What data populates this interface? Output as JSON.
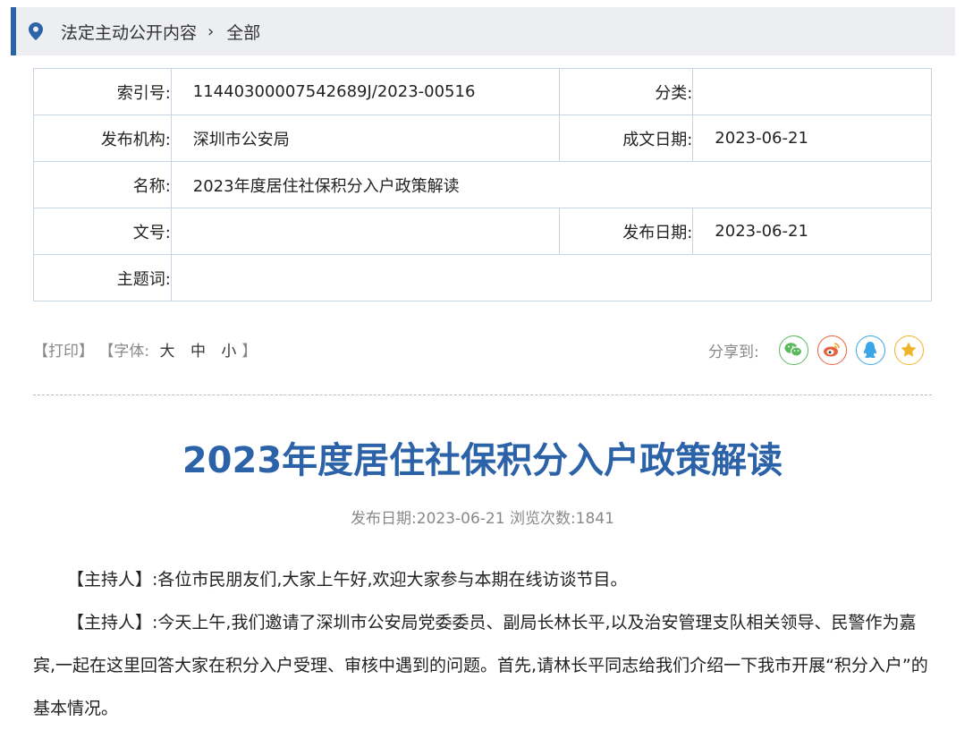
{
  "breadcrumb": {
    "section": "法定主动公开内容",
    "current": "全部"
  },
  "meta": {
    "index_label": "索引号:",
    "index_value": "11440300007542689J/2023-00516",
    "category_label": "分类:",
    "category_value": "",
    "publisher_label": "发布机构:",
    "publisher_value": "深圳市公安局",
    "written_date_label": "成文日期:",
    "written_date_value": "2023-06-21",
    "name_label": "名称:",
    "name_value": "2023年度居住社保积分入户政策解读",
    "doc_no_label": "文号:",
    "doc_no_value": "",
    "publish_date_label": "发布日期:",
    "publish_date_value": "2023-06-21",
    "keywords_label": "主题词:",
    "keywords_value": ""
  },
  "tools": {
    "print": "【打印】",
    "font_prefix": "【字体:",
    "large": "大",
    "medium": "中",
    "small": "小",
    "font_suffix": "】",
    "share_label": "分享到:",
    "share_icons": [
      "wechat-icon",
      "weibo-icon",
      "qq-icon",
      "favorite-icon"
    ]
  },
  "colors": {
    "accent": "#2b62a8",
    "wechat": "#5cb85c",
    "weibo": "#e8603c",
    "qq": "#3aa6e6",
    "favorite": "#f0b429"
  },
  "article": {
    "title": "2023年度居住社保积分入户政策解读",
    "subinfo": "发布日期:2023-06-21  浏览次数:1841",
    "paragraphs": [
      "【主持人】:各位市民朋友们,大家上午好,欢迎大家参与本期在线访谈节目。",
      "【主持人】:今天上午,我们邀请了深圳市公安局党委委员、副局长林长平,以及治安管理支队相关领导、民警作为嘉宾,一起在这里回答大家在积分入户受理、审核中遇到的问题。首先,请林长平同志给我们介绍一下我市开展“积分入户”的基本情况。"
    ]
  }
}
